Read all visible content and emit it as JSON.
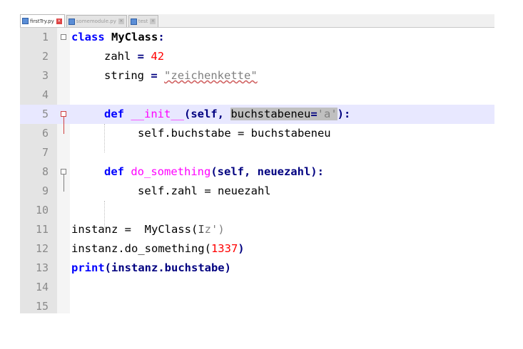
{
  "tabs": [
    {
      "label": "firstTry.py",
      "active": true
    },
    {
      "label": "somemodule.py",
      "active": false
    },
    {
      "label": "test",
      "active": false
    }
  ],
  "editor": {
    "line_numbers": [
      "1",
      "2",
      "3",
      "4",
      "5",
      "6",
      "7",
      "8",
      "9",
      "10",
      "11",
      "12",
      "13",
      "14",
      "15"
    ]
  },
  "code": {
    "l1": {
      "kw": "class",
      "name": "MyClass",
      "rest": ":"
    },
    "l2": {
      "var": "zahl",
      "eq": "=",
      "val": "42"
    },
    "l3": {
      "var": "string",
      "eq": "=",
      "val": "\"zeichenkette\""
    },
    "l5": {
      "kw": "def",
      "fn": "__init__",
      "args": "(self, ",
      "sel": "buchstabeneu",
      "eq": "=",
      "str": "'a'",
      "end": "):"
    },
    "l6": {
      "text": "self.buchstabe = buchstabeneu"
    },
    "l8": {
      "kw": "def",
      "fn": "do_something",
      "args": "(self, neuezahl):"
    },
    "l9": {
      "text": "self.zahl = neuezahl"
    },
    "l11": {
      "text": "instanz =  MyClass(",
      "cursor": "I",
      "rest": "z')"
    },
    "l12": {
      "text": "instanz.do_something(",
      "num": "1337",
      "end": ")"
    },
    "l13": {
      "kw": "print",
      "rest": "(instanz.buchstabe)"
    }
  },
  "colors": {
    "keyword": "#0000ff",
    "number": "#ff0000",
    "function": "#ff00ff",
    "string": "#808080",
    "current_line": "#e8e8ff"
  }
}
